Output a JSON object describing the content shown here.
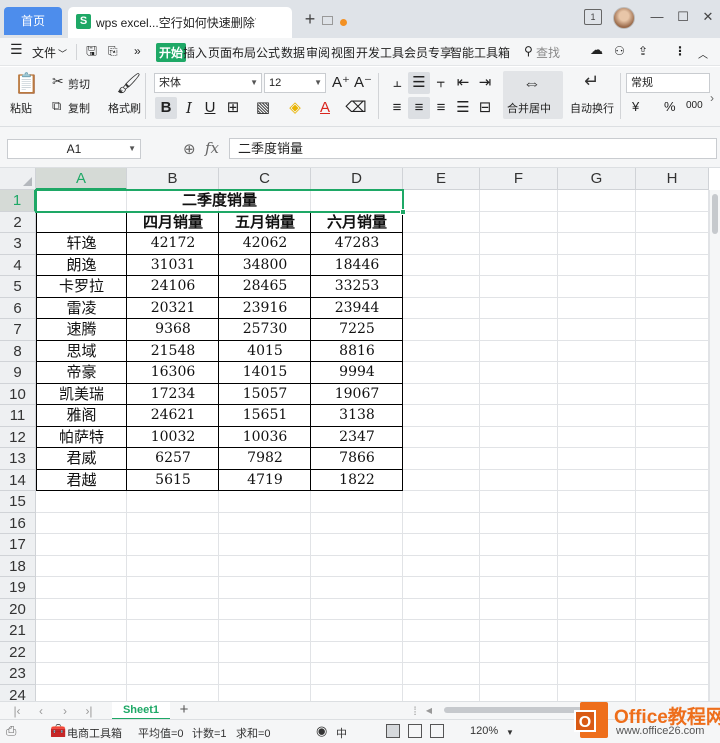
{
  "titlebar": {
    "home_tab": "首页",
    "doc_tab": "wps excel...空行如何快速删除？",
    "app_logo": "S",
    "page_indicator": "1"
  },
  "menu": {
    "file": "文件",
    "more": "»",
    "items": [
      "开始",
      "插入",
      "页面布局",
      "公式",
      "数据",
      "审阅",
      "视图",
      "开发工具",
      "会员专享",
      "智能工具箱"
    ],
    "search": "查找"
  },
  "ribbon": {
    "paste": "粘贴",
    "cut": "剪切",
    "copy": "复制",
    "format_painter": "格式刷",
    "font_name": "宋体",
    "font_size": "12",
    "merge_center": "合并居中",
    "wrap_text": "自动换行",
    "number_format": "常规",
    "currency": "¥",
    "percent": "%",
    "thousands": "000"
  },
  "formula_bar": {
    "cell_ref": "A1",
    "fx": "fx",
    "content": "二季度销量"
  },
  "grid": {
    "columns": [
      "A",
      "B",
      "C",
      "D",
      "E",
      "F",
      "G",
      "H"
    ],
    "rows": [
      "1",
      "2",
      "3",
      "4",
      "5",
      "6",
      "7",
      "8",
      "9",
      "10",
      "11",
      "12",
      "13",
      "14",
      "15",
      "16",
      "17",
      "18",
      "19",
      "20",
      "21",
      "22",
      "23",
      "24"
    ],
    "selected_column": "A",
    "selected_row": "1"
  },
  "table": {
    "title": "二季度销量",
    "headers": [
      "",
      "四月销量",
      "五月销量",
      "六月销量"
    ],
    "rows": [
      [
        "轩逸",
        "42172",
        "42062",
        "47283"
      ],
      [
        "朗逸",
        "31031",
        "34800",
        "18446"
      ],
      [
        "卡罗拉",
        "24106",
        "28465",
        "33253"
      ],
      [
        "雷凌",
        "20321",
        "23916",
        "23944"
      ],
      [
        "速腾",
        "9368",
        "25730",
        "7225"
      ],
      [
        "思域",
        "21548",
        "4015",
        "8816"
      ],
      [
        "帝豪",
        "16306",
        "14015",
        "9994"
      ],
      [
        "凯美瑞",
        "17234",
        "15057",
        "19067"
      ],
      [
        "雅阁",
        "24621",
        "15651",
        "3138"
      ],
      [
        "帕萨特",
        "10032",
        "10036",
        "2347"
      ],
      [
        "君威",
        "6257",
        "7982",
        "7866"
      ],
      [
        "君越",
        "5615",
        "4719",
        "1822"
      ]
    ]
  },
  "sheets": {
    "active": "Sheet1"
  },
  "status": {
    "toolbox": "电商工具箱",
    "average": "平均值=0",
    "count": "计数=1",
    "sum": "求和=0",
    "lang": "中",
    "zoom": "120%"
  },
  "watermark": {
    "title": "Office教程网",
    "url": "www.office26.com",
    "logo_letter": "O"
  }
}
